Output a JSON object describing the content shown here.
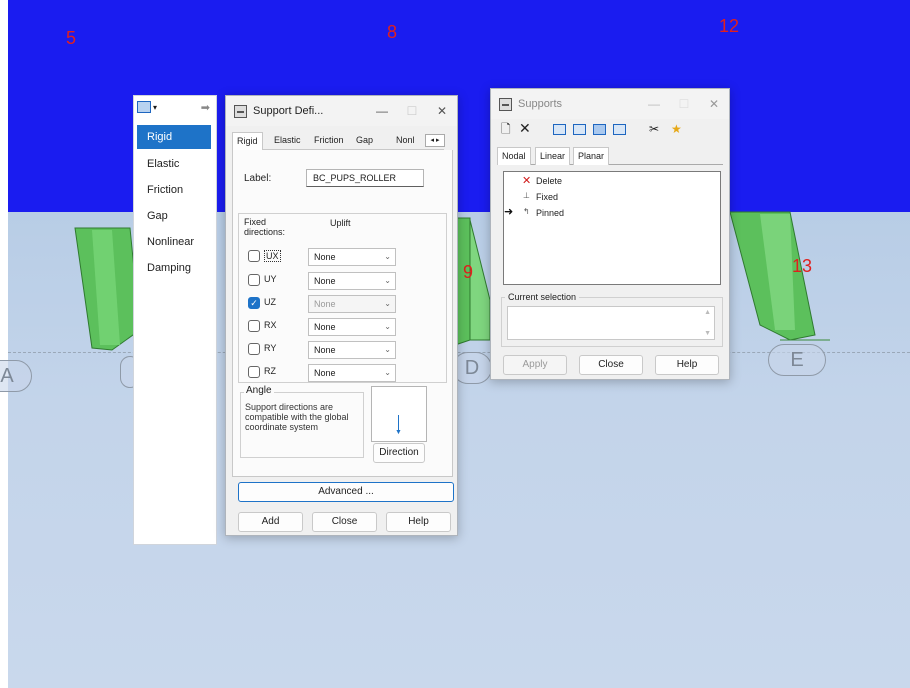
{
  "scene": {
    "node_numbers": [
      "5",
      "8",
      "12",
      "9",
      "13"
    ],
    "grid_labels": [
      "A",
      "D",
      "E"
    ]
  },
  "menu_panel": {
    "items": [
      {
        "label": "Rigid",
        "selected": true
      },
      {
        "label": "Elastic"
      },
      {
        "label": "Friction"
      },
      {
        "label": "Gap"
      },
      {
        "label": "Nonlinear"
      },
      {
        "label": "Damping"
      }
    ]
  },
  "support_def": {
    "title": "Support Defi...",
    "tabs": [
      "Rigid",
      "Elastic",
      "Friction",
      "Gap",
      "Nonl"
    ],
    "label_caption": "Label:",
    "label_value": "BC_PUPS_ROLLER",
    "fixed_directions_label": "Fixed directions:",
    "uplift_label": "Uplift",
    "directions": [
      {
        "name": "UX",
        "checked": false,
        "uplift": "None",
        "enabled": true
      },
      {
        "name": "UY",
        "checked": false,
        "uplift": "None",
        "enabled": true
      },
      {
        "name": "UZ",
        "checked": true,
        "uplift": "None",
        "enabled": false
      },
      {
        "name": "RX",
        "checked": false,
        "uplift": "None",
        "enabled": true
      },
      {
        "name": "RY",
        "checked": false,
        "uplift": "None",
        "enabled": true
      },
      {
        "name": "RZ",
        "checked": false,
        "uplift": "None",
        "enabled": true
      }
    ],
    "angle_label": "Angle",
    "angle_text": "Support directions are compatible with the global coordinate system",
    "direction_button": "Direction",
    "advanced_button": "Advanced ...",
    "add_button": "Add",
    "close_button": "Close",
    "help_button": "Help"
  },
  "supports_win": {
    "title": "Supports",
    "tabs": [
      "Nodal",
      "Linear",
      "Planar"
    ],
    "items": [
      "Delete",
      "Fixed",
      "Pinned"
    ],
    "current_selection_label": "Current selection",
    "apply_button": "Apply",
    "close_button": "Close",
    "help_button": "Help"
  },
  "colors": {
    "viewport_blue": "#1a1cf0",
    "node_number": "#e0201e",
    "selection": "#1e73c8",
    "beam_green": "#5cc05c"
  }
}
